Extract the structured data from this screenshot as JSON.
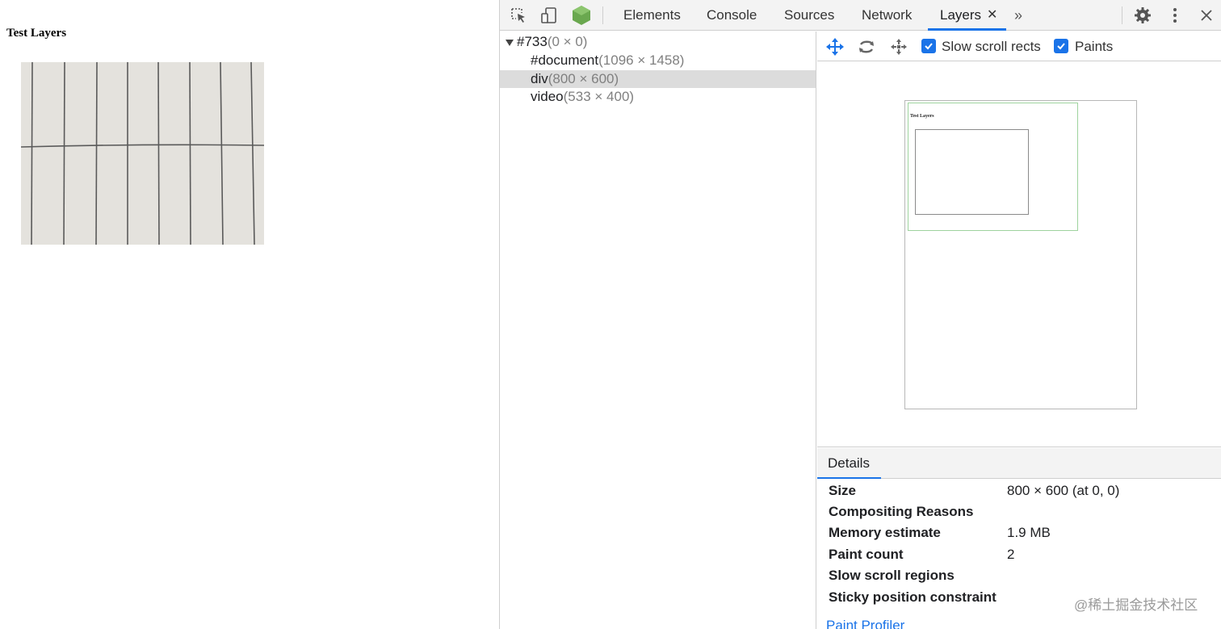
{
  "page": {
    "title": "Test Layers"
  },
  "devtools": {
    "tabs": {
      "elements": "Elements",
      "console": "Console",
      "sources": "Sources",
      "network": "Network",
      "layers": "Layers"
    },
    "close_glyph": "✕",
    "more_glyph": "»",
    "icons": [
      "inspect-element-icon",
      "device-toolbar-icon",
      "node-hexagon-icon",
      "gear-icon",
      "kebab-menu-icon",
      "close-icon"
    ]
  },
  "tree": {
    "rows": [
      {
        "name": "#733",
        "dims": "(0 × 0)"
      },
      {
        "name": "#document",
        "dims": "(1096 × 1458)"
      },
      {
        "name": "div",
        "dims": "(800 × 600)",
        "selected": true
      },
      {
        "name": "video",
        "dims": "(533 × 400)"
      }
    ]
  },
  "layers_toolbar": {
    "slow_scroll_label": "Slow scroll rects",
    "paints_label": "Paints",
    "slow_scroll_checked": true,
    "paints_checked": true
  },
  "viewport": {
    "mini_title": "Test Layers"
  },
  "details": {
    "tab": "Details",
    "rows": [
      {
        "label": "Size",
        "value": "800 × 600 (at 0, 0)"
      },
      {
        "label": "Compositing Reasons",
        "value": ""
      },
      {
        "label": "Memory estimate",
        "value": "1.9 MB"
      },
      {
        "label": "Paint count",
        "value": "2"
      },
      {
        "label": "Slow scroll regions",
        "value": ""
      },
      {
        "label": "Sticky position constraint",
        "value": ""
      }
    ],
    "paint_profiler": "Paint Profiler",
    "watermark": "@稀土掘金技术社区"
  },
  "colors": {
    "accent": "#1a73e8",
    "selected_row": "#dcdcdc",
    "node_icon": "#6aa84f"
  }
}
